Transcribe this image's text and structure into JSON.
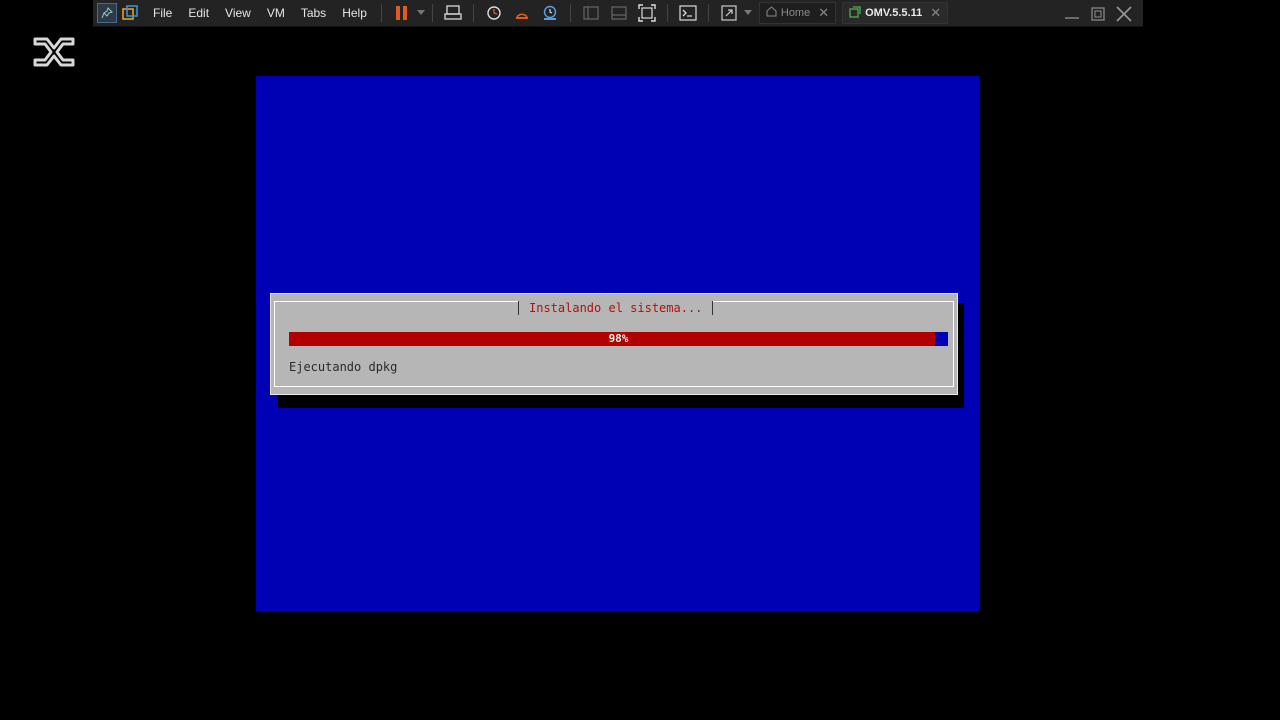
{
  "toolbar": {
    "menu": [
      "File",
      "Edit",
      "View",
      "VM",
      "Tabs",
      "Help"
    ],
    "tabs": [
      {
        "label": "Home",
        "active": false
      },
      {
        "label": "OMV.5.5.11",
        "active": true
      }
    ],
    "accent_pause_color": "#e05a1e"
  },
  "installer": {
    "title": "Instalando el sistema...",
    "progress_percent": 98,
    "progress_label": "98%",
    "status": "Ejecutando dpkg",
    "colors": {
      "background": "#0000b4",
      "dialog": "#b6b6b6",
      "bar": "#b00000",
      "title": "#b01010"
    }
  }
}
